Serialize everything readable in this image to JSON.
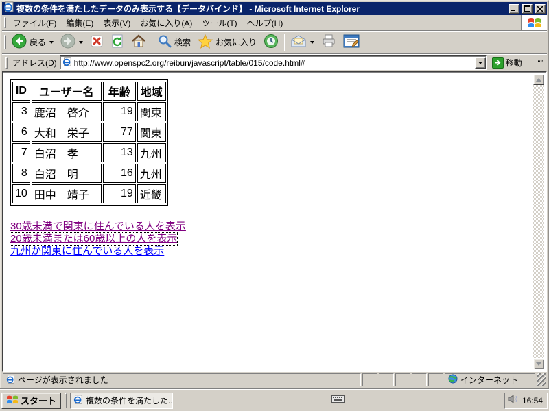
{
  "window": {
    "title": "複数の条件を満たしたデータのみ表示する【データバインド】 - Microsoft Internet Explorer"
  },
  "menu": {
    "items": [
      "ファイル(F)",
      "編集(E)",
      "表示(V)",
      "お気に入り(A)",
      "ツール(T)",
      "ヘルプ(H)"
    ]
  },
  "toolbar": {
    "back_label": "戻る",
    "search_label": "検索",
    "favorites_label": "お気に入り"
  },
  "address": {
    "label": "アドレス(D)",
    "url": "http://www.openspc2.org/reibun/javascript/table/015/code.html#",
    "go_label": "移動",
    "links_label": "“”"
  },
  "content": {
    "table": {
      "headers": [
        "ID",
        "ユーザー名",
        "年齢",
        "地域"
      ],
      "rows": [
        [
          "3",
          "鹿沼　啓介",
          "19",
          "関東"
        ],
        [
          "6",
          "大和　栄子",
          "77",
          "関東"
        ],
        [
          "7",
          "白沼　孝",
          "13",
          "九州"
        ],
        [
          "8",
          "白沼　明",
          "16",
          "九州"
        ],
        [
          "10",
          "田中　靖子",
          "19",
          "近畿"
        ]
      ]
    },
    "links": [
      {
        "text": "30歳未満で関東に住んでいる人を表示",
        "state": "visited"
      },
      {
        "text": "20歳未満または60歳以上の人を表示",
        "state": "visited-focused"
      },
      {
        "text": "九州か関東に住んでいる人を表示",
        "state": "unvisited"
      }
    ]
  },
  "statusbar": {
    "message": "ページが表示されました",
    "zone": "インターネット"
  },
  "taskbar": {
    "start_label": "スタート",
    "task_label": "複数の条件を満たした...",
    "clock": "16:54"
  },
  "colors": {
    "titlebar": "#0A246A",
    "chrome": "#D4D0C8",
    "link_visited": "#800080",
    "link_unvisited": "#0000FF",
    "go_green": "#2DA12D"
  }
}
